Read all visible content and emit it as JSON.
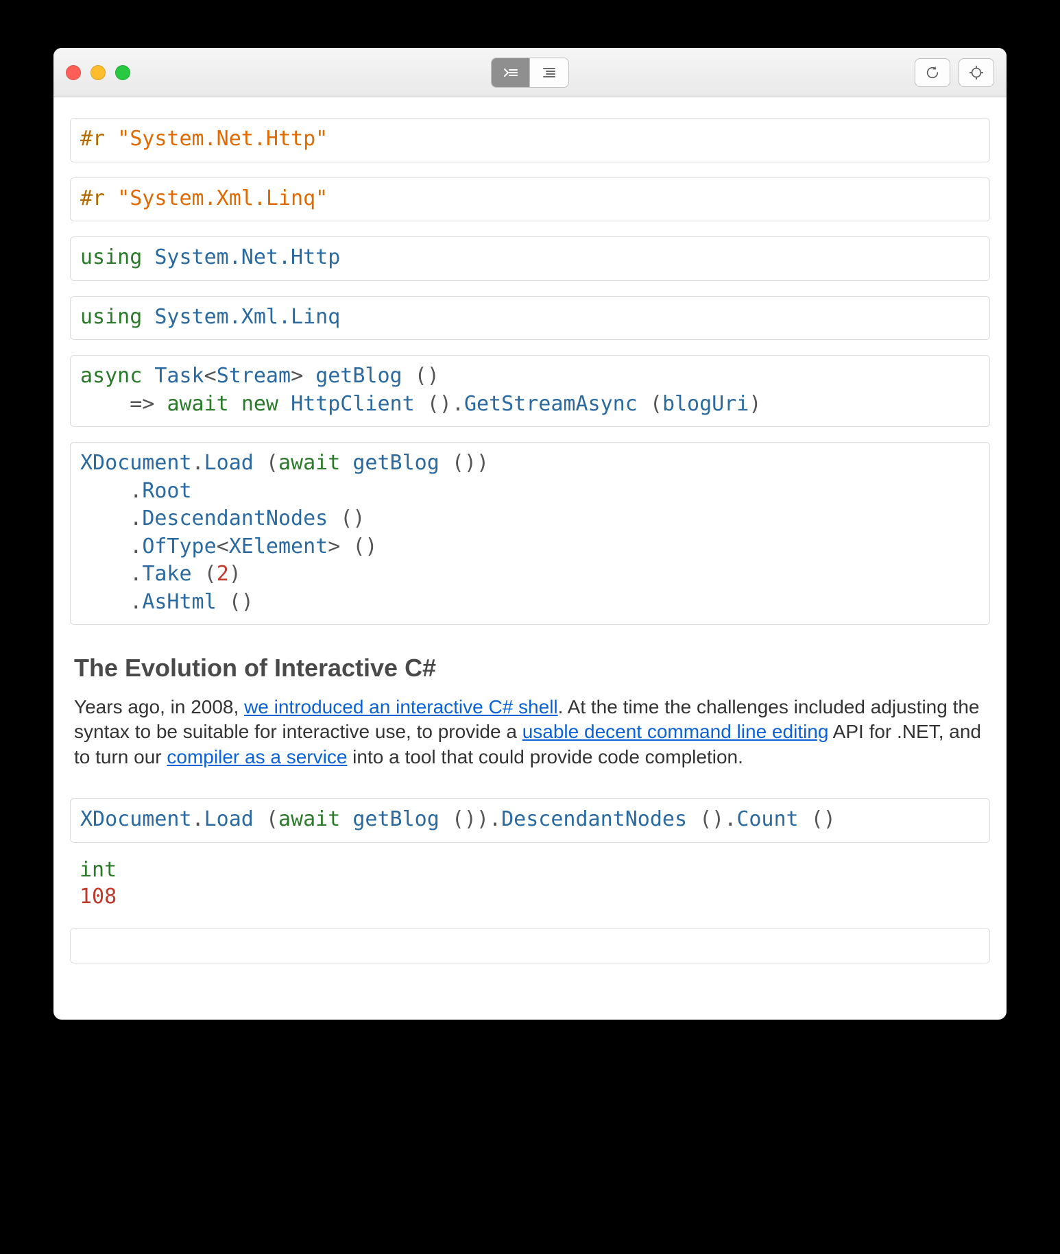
{
  "cells": {
    "c1": {
      "directive": "#r",
      "arg": "\"System.Net.Http\""
    },
    "c2": {
      "directive": "#r",
      "arg": "\"System.Xml.Linq\""
    },
    "c3": {
      "keyword": "using",
      "ns": "System.Net.Http"
    },
    "c4": {
      "keyword": "using",
      "ns": "System.Xml.Linq"
    },
    "c5": {
      "kw_async": "async",
      "type_task": "Task",
      "lt": "<",
      "type_stream": "Stream",
      "gt": ">",
      "space1": " ",
      "method": "getBlog",
      "sig_tail": " ()",
      "indent": "    ",
      "arrow": "=> ",
      "kw_await": "await",
      "space2": " ",
      "kw_new": "new",
      "space3": " ",
      "type_httpclient": "HttpClient",
      "call1": " ().",
      "m_getstream": "GetStreamAsync",
      "call2": " (",
      "arg_bloguri": "blogUri",
      "call3": ")"
    },
    "c6": {
      "t_xdoc": "XDocument",
      "dot1": ".",
      "m_load": "Load",
      "p_open": " (",
      "kw_await": "await",
      "sp": " ",
      "m_getblog": "getBlog",
      "p_close": " ())",
      "indent": "    .",
      "m_root": "Root",
      "m_desc": "DescendantNodes",
      "call_empty": " ()",
      "m_oftype": "OfType",
      "lt": "<",
      "t_xel": "XElement",
      "gt": ">",
      "m_take": "Take",
      "p_open2": " (",
      "num2": "2",
      "p_close2": ")",
      "m_ashtml": "AsHtml"
    },
    "c7": {
      "t_xdoc": "XDocument",
      "dot": ".",
      "m_load": "Load",
      "p_open": " (",
      "kw_await": "await",
      "sp": " ",
      "m_getblog": "getBlog",
      "p_mid": " ()).",
      "m_desc": "DescendantNodes",
      "p_mid2": " ().",
      "m_count": "Count",
      "p_end": " ()"
    }
  },
  "article": {
    "title": "The Evolution of Interactive C#",
    "p1a": "Years ago, in 2008, ",
    "link1": "we introduced an interactive C# shell",
    "p1b": ". At the time the challenges included adjusting the syntax to be suitable for interactive use, to provide a ",
    "link2": "usable decent command line editing",
    "p1c": " API for .NET, and to turn our ",
    "link3": "compiler as a service",
    "p1d": " into a tool that could provide code completion."
  },
  "result": {
    "type": "int",
    "value": "108"
  }
}
